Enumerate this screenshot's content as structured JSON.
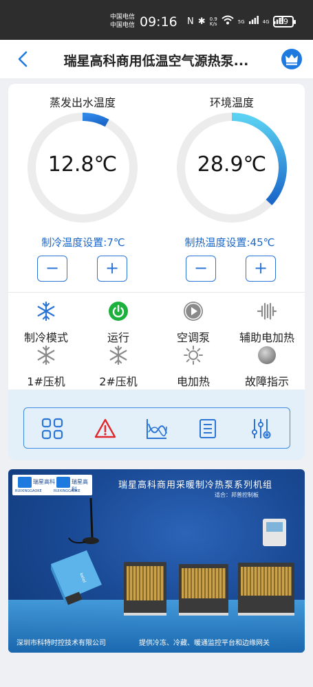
{
  "status_bar": {
    "carrier_1": "中国电信",
    "carrier_2": "中国电信",
    "time": "09:16",
    "net_speed_value": "0.9",
    "net_speed_unit": "K/s",
    "sim_1": "5G",
    "sim_2": "4G",
    "battery": "69"
  },
  "header": {
    "title": "瑞星高科商用低温空气源热泵..."
  },
  "gauges": [
    {
      "label": "蒸发出水温度",
      "value": "12.8℃",
      "fraction": 0.08,
      "set_label": "制冷温度设置:7℃"
    },
    {
      "label": "环境温度",
      "value": "28.9℃",
      "fraction": 0.37,
      "set_label": "制热温度设置:45℃"
    }
  ],
  "controls": {
    "minus": "−",
    "plus": "+"
  },
  "status_row_1": [
    {
      "label": "制冷模式",
      "icon": "snowflake-icon",
      "active": true
    },
    {
      "label": "运行",
      "icon": "power-icon",
      "active": true
    },
    {
      "label": "空调泵",
      "icon": "play-icon",
      "active": false
    },
    {
      "label": "辅助电加热",
      "icon": "heater-icon",
      "active": false
    }
  ],
  "status_row_2": [
    {
      "label": "1#压机",
      "icon": "snowflake-icon",
      "active": false
    },
    {
      "label": "2#压机",
      "icon": "snowflake-icon",
      "active": false
    },
    {
      "label": "电加热",
      "icon": "sun-icon",
      "active": false
    },
    {
      "label": "故障指示",
      "icon": "indicator-light-icon",
      "active": false
    }
  ],
  "toolbar": [
    "grid-menu-icon",
    "warning-icon",
    "trend-chart-icon",
    "list-icon",
    "settings-sliders-icon"
  ],
  "colors": {
    "accent": "#2a74d6",
    "run_green": "#1bb13c",
    "alarm_red": "#e0252b",
    "inactive_gray": "#8a8a8a"
  },
  "banner": {
    "title": "瑞星高科商用采暖制冷热泵系列机组",
    "subtitle": "适合：邦普控制板",
    "logo_1": "瑞星高科",
    "logo_2": "瑞星高科",
    "logo_1_en": "RUIXINGGAOKE",
    "logo_2_en": "RUIXINGGAOKE",
    "device_brand": "ketel",
    "footer_left": "深圳市科特时控技术有限公司",
    "footer_right": "提供冷冻、冷藏、暖通监控平台和边缘网关"
  }
}
